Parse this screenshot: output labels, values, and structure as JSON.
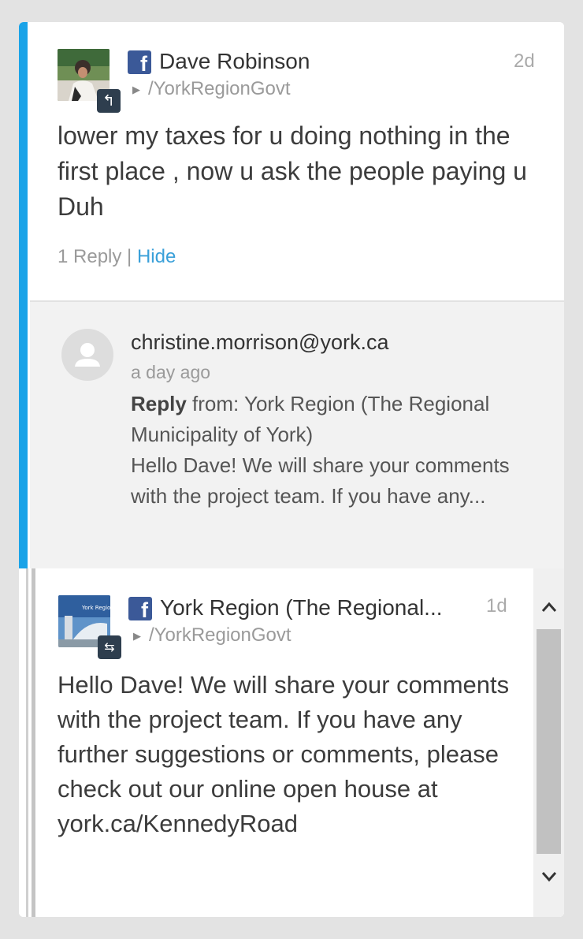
{
  "post1": {
    "author": "Dave Robinson",
    "page": "/YorkRegionGovt",
    "time": "2d",
    "text": "lower my taxes for u doing nothing in the first place , now u ask the people paying u Duh",
    "reply_count": "1 Reply",
    "separator": " | ",
    "hide_label": "Hide",
    "badge_icon": "reply-icon"
  },
  "reply": {
    "email": "christine.morrison@york.ca",
    "time": "a day ago",
    "label": "Reply",
    "from": " from: York Region (The Regional Municipality of York)",
    "text": "Hello Dave! We will share your comments with the project team. If you have any..."
  },
  "post2": {
    "author": "York Region (The Regional...",
    "page": "/YorkRegionGovt",
    "time": "1d",
    "text": "Hello Dave! We will share your comments with the project team. If you have any further suggestions or comments, please check out our online open house at york.ca/KennedyRoad",
    "badge_icon": "outgoing-icon"
  },
  "colors": {
    "accent": "#1aa3e8",
    "facebook": "#3b5998",
    "link": "#3aa0d9"
  }
}
